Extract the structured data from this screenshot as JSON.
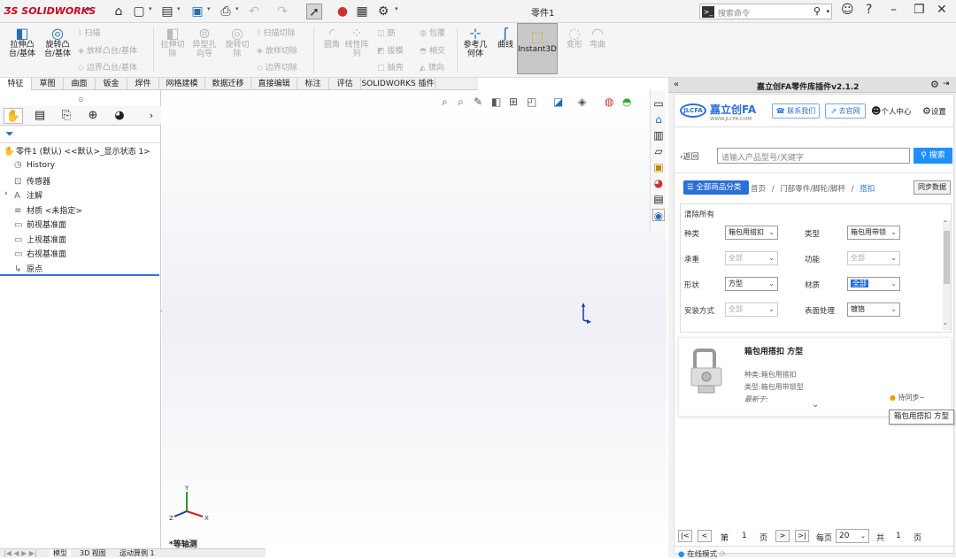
{
  "app": {
    "logo": "SOLIDWORKS",
    "doc_title": "零件1",
    "search_placeholder": "搜索命令"
  },
  "ribbon": {
    "extrude": "拉伸凸\n台/基体",
    "revolve": "旋转凸\n台/基体",
    "sweep": "扫描",
    "loft": "放样凸台/基体",
    "boundary": "边界凸台/基体",
    "extrude_cut": "拉伸切\n除",
    "hole_wizard": "异型孔\n向导",
    "revolve_cut": "旋转切\n除",
    "sweep_cut": "扫描切除",
    "loft_cut": "放样切除",
    "boundary_cut": "边界切除",
    "fillet": "圆角",
    "linear_pattern": "线性阵\n列",
    "rib": "筋",
    "draft": "拔模",
    "shell": "抽壳",
    "wrap": "包覆",
    "intersect": "相交",
    "mirror": "镜向",
    "ref_geom": "参考几\n何体",
    "curves": "曲线",
    "instant3d": "Instant3D",
    "deform": "变形",
    "indent": "弯曲"
  },
  "tabs": [
    "特征",
    "草图",
    "曲面",
    "钣金",
    "焊件",
    "网格建模",
    "数据迁移",
    "直接编辑",
    "标注",
    "评估",
    "SOLIDWORKS 插件"
  ],
  "tree": {
    "root": "零件1 (默认) <<默认>_显示状态 1>",
    "items": [
      "History",
      "传感器",
      "注解",
      "材质 <未指定>",
      "前视基准面",
      "上视基准面",
      "右视基准面",
      "原点"
    ]
  },
  "viewport": {
    "view_label": "*等轴测"
  },
  "bottom_tabs": [
    "模型",
    "3D 视图",
    "运动算例 1"
  ],
  "plugin": {
    "title": "嘉立创FA零件库插件v2.1.2",
    "logo_text": "JLCFA",
    "logo_url": "WWW.JLCFA.COM",
    "logo_cn": "嘉立创FA",
    "contact": "联系我们",
    "official": "去官网",
    "personal": "个人中心",
    "settings": "设置",
    "back": "返回",
    "search_placeholder": "请输入产品型号/关键字",
    "search_btn": "搜索",
    "all_categories": "全部商品分类",
    "breadcrumb": [
      "首页",
      "门部零件/脚轮/脚杯",
      "搭扣"
    ],
    "sync_data": "同步数据",
    "clear_all": "清除所有",
    "filters": [
      {
        "label": "种类",
        "value": "箱包用搭扣",
        "disabled": false
      },
      {
        "label": "类型",
        "value": "箱包用带锁",
        "disabled": false
      },
      {
        "label": "承重",
        "value": "全部",
        "disabled": true
      },
      {
        "label": "功能",
        "value": "全部",
        "disabled": true
      },
      {
        "label": "形状",
        "value": "方型",
        "disabled": false
      },
      {
        "label": "材质",
        "value": "全部",
        "disabled": false,
        "highlight": true
      },
      {
        "label": "安装方式",
        "value": "全部",
        "disabled": true
      },
      {
        "label": "表面处理",
        "value": "镀铬",
        "disabled": false
      }
    ],
    "product": {
      "name": "箱包用搭扣 方型",
      "kind": "种类:箱包用搭扣",
      "type": "类型:箱包用带锁型",
      "stock": "最新于:",
      "status": "待同步~"
    },
    "pager": {
      "page_label": "第",
      "page": "1",
      "page_unit": "页",
      "per_page_label": "每页",
      "per_page": "20",
      "total_label": "共",
      "total": "1",
      "total_unit": "页"
    },
    "mode": "在线模式"
  },
  "tooltip": "箱包用搭扣 方型",
  "colors": {
    "accent": "#2c6fd6",
    "brand": "#d0021b",
    "search_btn": "#1e90ff"
  }
}
